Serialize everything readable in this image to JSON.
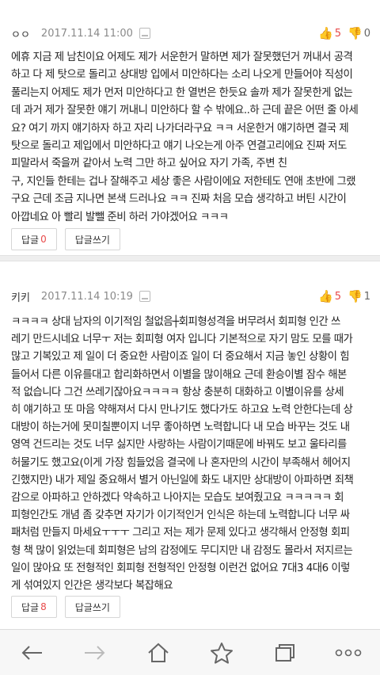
{
  "comments": [
    {
      "author": "ㅇㅇ",
      "date": "2017.11.14 11:00",
      "up_count": "5",
      "down_count": "0",
      "lines": [
        "에휴 지금 제 남친이요 어제도 제가 서운한거 말하면 제가 잘못했던거 꺼내서 공격",
        "하고 다 제 탓으로 돌리고 상대방 입에서 미안하다는 소리 나오게 만들어야 직성이",
        "풀리는지 어제도 제가 먼저 미안하다고 한 열번은 한듯요 솔까 제가 잘못한게 없는",
        "데 과거 제가 잘못한 얘기 꺼내니 미안하다 할 수 밖에요..하 근데 끝은 어떤 줄 아세",
        "요? 여기 까지 얘기하자 하고 자리 나가더라구요 ㅋㅋ 서운한거 얘기하면 결국 제",
        "탓으로 돌리고 제입에서 미안하다고 얘기 나오는게 아주 연결고리에요 진짜 저도",
        "피말라서 죽을꺼 같아서 노력 그만 하고 싶어요 자기 가족, 주변 친",
        "구, 지인들 한테는 겁나 잘해주고 세상 좋은 사람이에요 저한테도 연애 초반에 그랬",
        "구요 근데 조금 지나면 본색 드러나요 ㅋㅋ 진짜 처음 모습 생각하고 버틴 시간이",
        "아깝네요 아 빨리 발뺄 준비 하러 가야겠어요 ㅋㅋㅋ"
      ],
      "reply_label": "답글",
      "reply_count": "0",
      "write_reply_label": "답글쓰기"
    },
    {
      "author": "키키",
      "date": "2017.11.14 10:19",
      "up_count": "5",
      "down_count": "1",
      "lines": [
        "ㅋㅋㅋㅋ 상대 남자의 이기적임 철없음┼회피형성격을 버무려서 회피형 인간 쓰",
        "레기 만드시네요 너무ㅜ 저는 회피형 여자 입니다 기본적으로 자기 맘도 모를 때가",
        "많고 기복있고 제 일이 더 중요한 사람이죠 일이 더 중요해서 지금 놓인 상황이 힘",
        "들어서 다른 이유를대고 합리화하면서 이별을 많이해요 근데 환승이별 잠수 해본",
        "적 없습니다 그건 쓰레기잖아요ㅋㅋㅋㅋ 항상 충분히 대화하고 이별이유를 상세",
        "히 얘기하고 또 마음 약해져서 다시 만나기도 했다가도 하고요 노력 안한다는데 상",
        "대방이 하는거에 못미칠뿐이지 너무 좋아하면 노력합니다 내 모습 바꾸는 것도 내",
        "영역 건드리는 것도 너무 싫지만 사랑하는 사람이기때문에 바꿔도 보고 울타리를",
        "허물기도 했고요(이게 가장 힘들었음 결국에 나 혼자만의 시간이 부족해서 헤어지",
        "긴했지만) 내가 제일 중요해서 별거 아닌일에 화도 내지만 상대방이 아파하면 죄책",
        "감으로 아파하고 안하겠다 약속하고 나아지는 모습도 보여줬고요 ㅋㅋㅋㅋㅋ 회",
        "피형인간도 개념 좀 갖추면 자기가 이기적인거 인식은 하는데 노력합니다 너무 싸",
        "패처럼 만들지 마세요ㅜㅜㅜ 그리고 저는 제가 문제 있다고 생각해서 안정형 회피",
        "형 책 많이 읽었는데 회피형은 남의 감정에도 무디지만 내 감정도 몰라서 저지르는",
        "일이 많아요 또 전형적인 회피형 전형적인 안정형 이런건 없어요 7대3 4대6 이렇",
        "게 섞여있지 인간은 생각보다 복잡해요"
      ],
      "reply_label": "답글",
      "reply_count": "8",
      "write_reply_label": "답글쓰기"
    }
  ],
  "bottom_nav": {
    "back_icon": "back-arrow-icon",
    "forward_icon": "forward-arrow-icon",
    "home_icon": "home-icon",
    "bookmark_icon": "star-icon",
    "tabs_icon": "tabs-icon",
    "menu_icon": "more-dots-icon"
  },
  "colors": {
    "accent_red": "#e84a4a",
    "divider_gray": "#eeeeee"
  }
}
